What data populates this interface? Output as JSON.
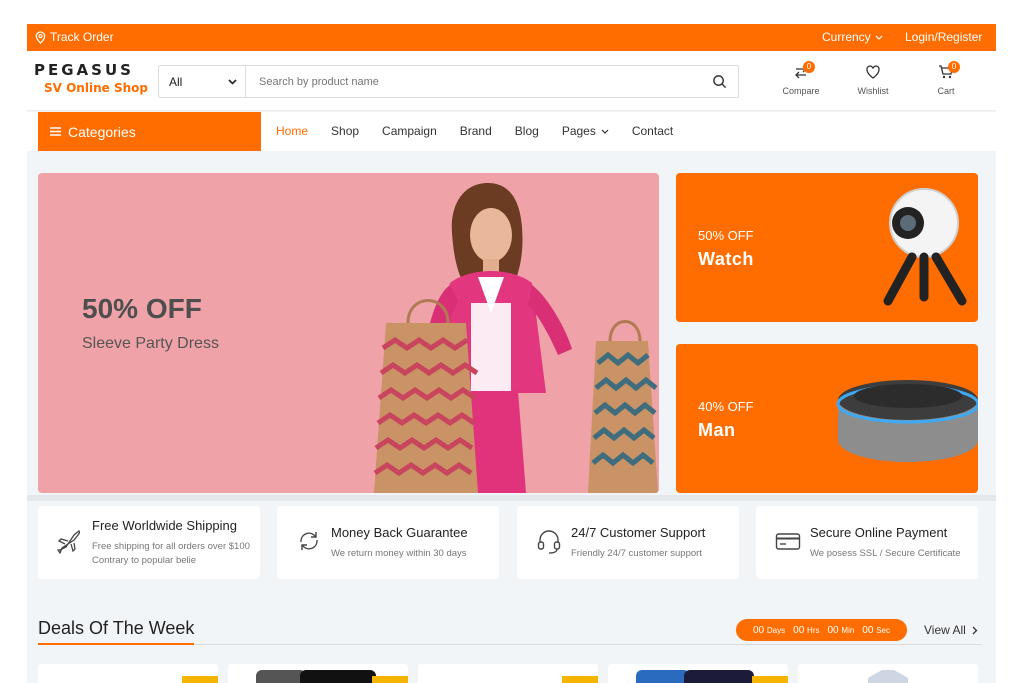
{
  "topbar": {
    "track_order": "Track Order",
    "currency": "Currency",
    "login": "Login/Register"
  },
  "logo": {
    "main": "PEGASUS",
    "sub": "SV Online Shop"
  },
  "search": {
    "category": "All",
    "placeholder": "Search by product name"
  },
  "header_icons": [
    {
      "label": "Compare",
      "count": "0",
      "icon": "compare-icon"
    },
    {
      "label": "Wishlist",
      "icon": "heart-icon"
    },
    {
      "label": "Cart",
      "count": "0",
      "icon": "cart-icon"
    }
  ],
  "categories_label": "Categories",
  "nav": [
    "Home",
    "Shop",
    "Campaign",
    "Brand",
    "Blog",
    "Pages",
    "Contact"
  ],
  "hero": {
    "off": "50% OFF",
    "sub": "Sleeve Party Dress"
  },
  "promos": [
    {
      "off": "50% OFF",
      "title": "Watch"
    },
    {
      "off": "40% OFF",
      "title": "Man"
    }
  ],
  "features": [
    {
      "title": "Free Worldwide Shipping",
      "desc": "Free shipping for all orders over $100 Contrary to popular belie",
      "icon": "airplane-icon"
    },
    {
      "title": "Money Back Guarantee",
      "desc": "We return money within 30 days",
      "icon": "refresh-icon"
    },
    {
      "title": "24/7 Customer Support",
      "desc": "Friendly 24/7 customer support",
      "icon": "headset-icon"
    },
    {
      "title": "Secure Online Payment",
      "desc": "We posess SSL / Secure Certificate",
      "icon": "credit-card-icon"
    }
  ],
  "deals": {
    "title": "Deals Of The Week",
    "timer": [
      {
        "value": "00",
        "unit": "Days"
      },
      {
        "value": "00",
        "unit": "Hrs"
      },
      {
        "value": "00",
        "unit": "Min"
      },
      {
        "value": "00",
        "unit": "Sec"
      }
    ],
    "view_all": "View All"
  },
  "colors": {
    "accent": "#ff6d00",
    "hero_bg": "#efa3a8",
    "page_bg": "#f2f5f8"
  }
}
